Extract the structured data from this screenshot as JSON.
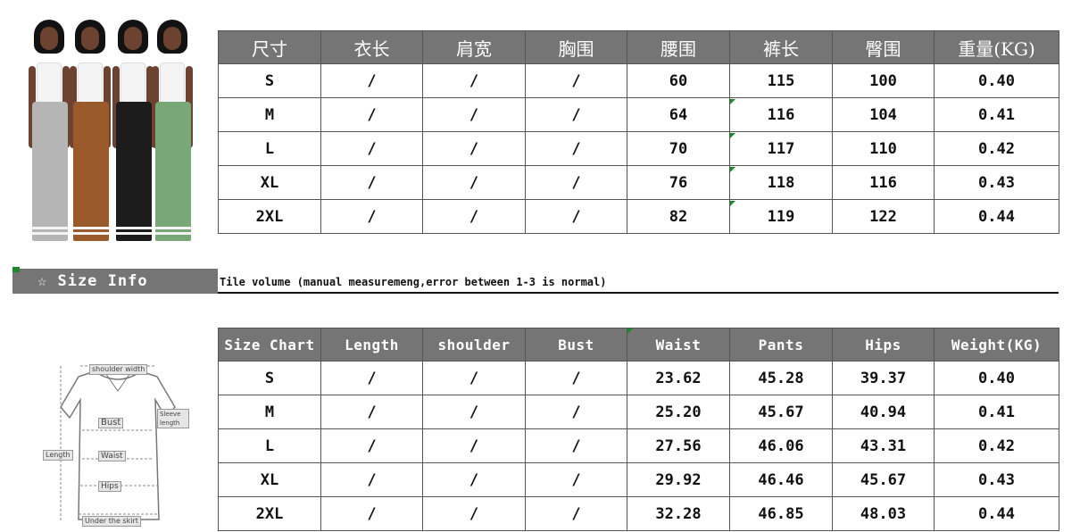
{
  "cn_table": {
    "headers": [
      "尺寸",
      "衣长",
      "肩宽",
      "胸围",
      "腰围",
      "裤长",
      "臀围",
      "重量(KG)"
    ],
    "rows": [
      [
        "S",
        "/",
        "/",
        "/",
        "60",
        "115",
        "100",
        "0.40"
      ],
      [
        "M",
        "/",
        "/",
        "/",
        "64",
        "116",
        "104",
        "0.41"
      ],
      [
        "L",
        "/",
        "/",
        "/",
        "70",
        "117",
        "110",
        "0.42"
      ],
      [
        "XL",
        "/",
        "/",
        "/",
        "76",
        "118",
        "116",
        "0.43"
      ],
      [
        "2XL",
        "/",
        "/",
        "/",
        "82",
        "119",
        "122",
        "0.44"
      ]
    ]
  },
  "info_bar": {
    "label": "☆ Size Info",
    "note": "Tile volume (manual measuremeng,error between 1-3 is normal)"
  },
  "en_table": {
    "headers": [
      "Size Chart",
      "Length",
      "shoulder",
      "Bust",
      "Waist",
      "Pants",
      "Hips",
      "Weight(KG)"
    ],
    "rows": [
      [
        "S",
        "/",
        "/",
        "/",
        "23.62",
        "45.28",
        "39.37",
        "0.40"
      ],
      [
        "M",
        "/",
        "/",
        "/",
        "25.20",
        "45.67",
        "40.94",
        "0.41"
      ],
      [
        "L",
        "/",
        "/",
        "/",
        "27.56",
        "46.06",
        "43.31",
        "0.42"
      ],
      [
        "XL",
        "/",
        "/",
        "/",
        "29.92",
        "46.46",
        "45.67",
        "0.43"
      ],
      [
        "2XL",
        "/",
        "/",
        "/",
        "32.28",
        "46.85",
        "48.03",
        "0.44"
      ]
    ]
  },
  "diagram": {
    "labels": [
      "shoulder width",
      "Sleeve length",
      "Bust",
      "Waist",
      "Hips",
      "Length",
      "Under the skirt"
    ]
  },
  "colors": {
    "header_bg": "#757575",
    "marker_green": "#1a8a2a",
    "pants": [
      "#b5b5b5",
      "#9a5a2c",
      "#1c1c1c",
      "#78a878"
    ]
  }
}
